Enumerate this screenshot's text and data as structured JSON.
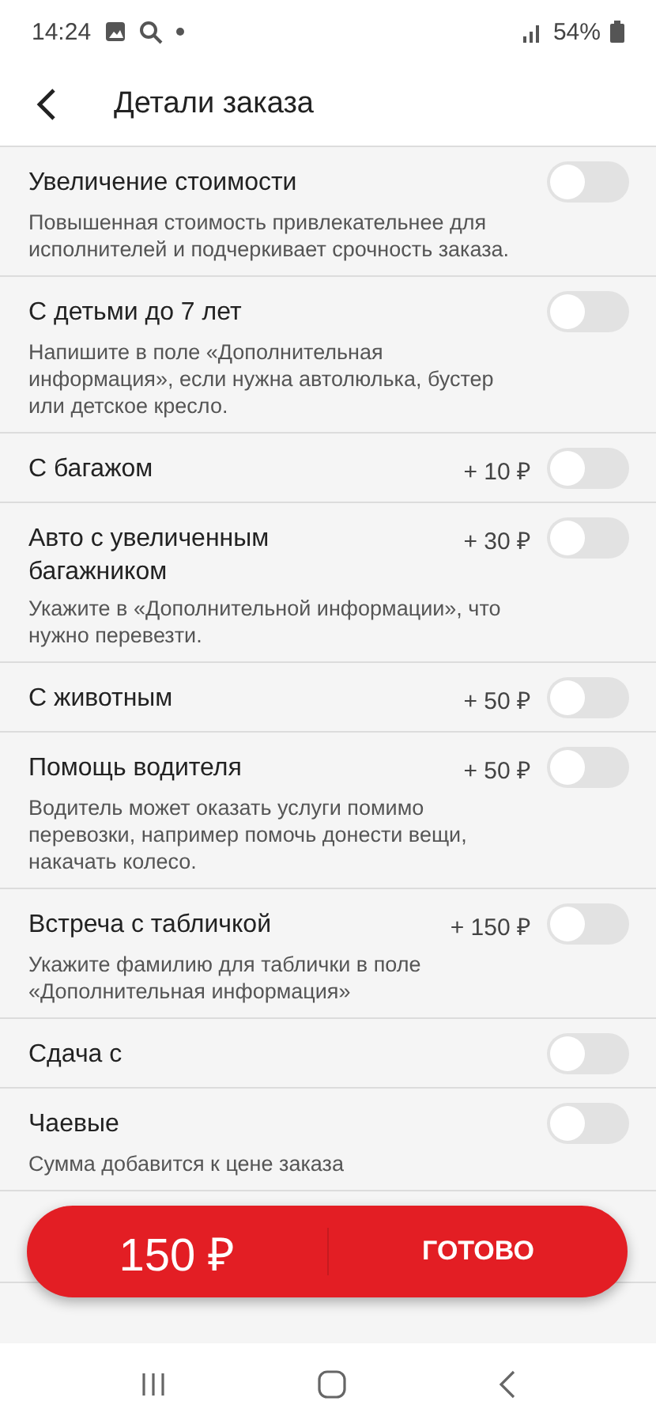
{
  "status_bar": {
    "time": "14:24",
    "battery": "54%"
  },
  "header": {
    "title": "Детали заказа"
  },
  "options": [
    {
      "title": "Увеличение стоимости",
      "description": "Повышенная стоимость привлекательнее для исполнителей и подчеркивает срочность заказа.",
      "on": false
    },
    {
      "title": "С детьми до 7 лет",
      "description": "Напишите в поле «Дополнительная информация», если нужна автолюлька, бустер или детское кресло.",
      "on": false
    },
    {
      "title": "С багажом",
      "price": "+ 10 ₽",
      "on": false
    },
    {
      "title": "Авто с увеличенным багажником",
      "price": "+ 30 ₽",
      "description": "Укажите в «Дополнительной информации», что нужно перевезти.",
      "on": false
    },
    {
      "title": "С животным",
      "price": "+ 50 ₽",
      "on": false
    },
    {
      "title": "Помощь водителя",
      "price": "+ 50 ₽",
      "description": "Водитель может оказать услуги помимо перевозки, например помочь донести вещи, накачать колесо.",
      "on": false
    },
    {
      "title": "Встреча с табличкой",
      "price": "+ 150 ₽",
      "description": "Укажите фамилию для таблички в поле «Дополнительная информация»",
      "on": false
    },
    {
      "title": "Сдача с",
      "on": false
    },
    {
      "title": "Чаевые",
      "description": "Сумма добавится к цене заказа",
      "on": false
    }
  ],
  "action_bar": {
    "total": "150 ₽",
    "button": "ГОТОВО"
  }
}
